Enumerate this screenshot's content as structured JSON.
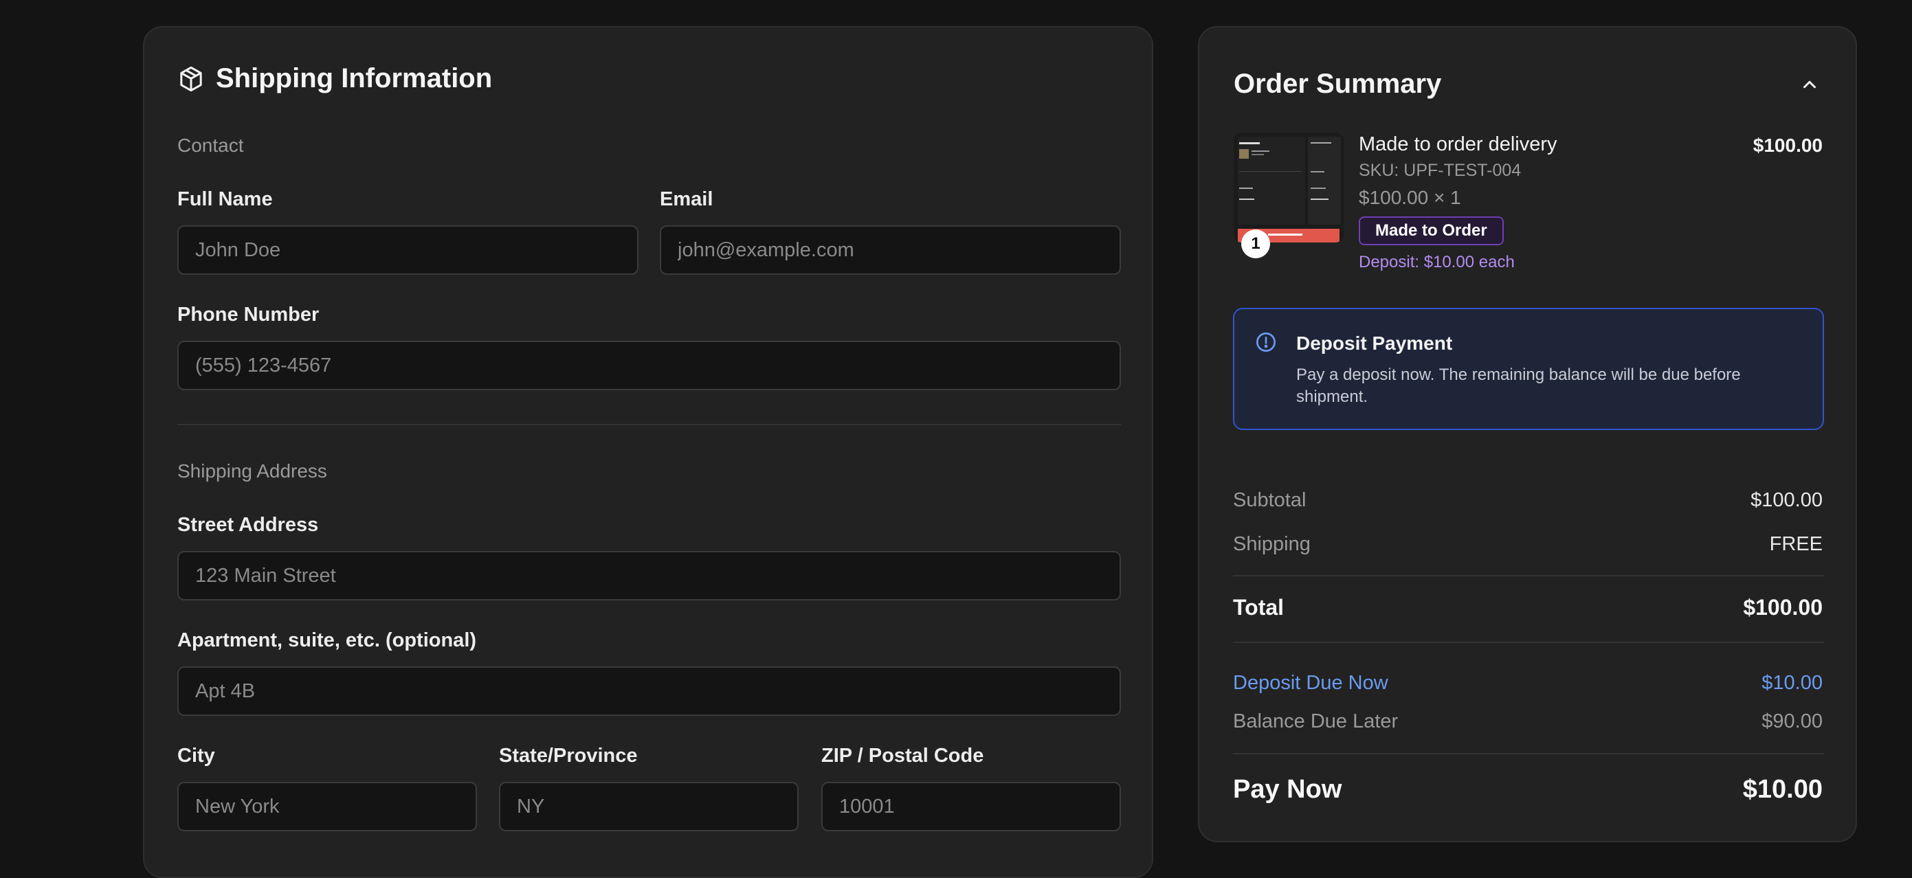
{
  "shipping": {
    "title": "Shipping Information",
    "contact_section": "Contact",
    "full_name_label": "Full Name",
    "full_name_placeholder": "John Doe",
    "email_label": "Email",
    "email_placeholder": "john@example.com",
    "phone_label": "Phone Number",
    "phone_placeholder": "(555) 123-4567",
    "address_section": "Shipping Address",
    "street_label": "Street Address",
    "street_placeholder": "123 Main Street",
    "apt_label": "Apartment, suite, etc. (optional)",
    "apt_placeholder": "Apt 4B",
    "city_label": "City",
    "city_placeholder": "New York",
    "state_label": "State/Province",
    "state_placeholder": "NY",
    "zip_label": "ZIP / Postal Code",
    "zip_placeholder": "10001"
  },
  "order": {
    "title": "Order Summary",
    "item": {
      "name": "Made to order delivery",
      "sku": "SKU: UPF-TEST-004",
      "unit_line": "$100.00 × 1",
      "badge": "Made to Order",
      "deposit_note": "Deposit: $10.00 each",
      "price": "$100.00",
      "quantity": "1"
    },
    "notice": {
      "title": "Deposit Payment",
      "text": "Pay a deposit now. The remaining balance will be due before shipment."
    },
    "subtotal_label": "Subtotal",
    "subtotal_value": "$100.00",
    "shipping_label": "Shipping",
    "shipping_value": "FREE",
    "total_label": "Total",
    "total_value": "$100.00",
    "deposit_due_label": "Deposit Due Now",
    "deposit_due_value": "$10.00",
    "balance_label": "Balance Due Later",
    "balance_value": "$90.00",
    "pay_now_label": "Pay Now",
    "pay_now_value": "$10.00"
  },
  "colors": {
    "background": "#141414",
    "card": "#222222",
    "accent_blue": "#6b9bf0",
    "accent_purple": "#b48cf0"
  }
}
